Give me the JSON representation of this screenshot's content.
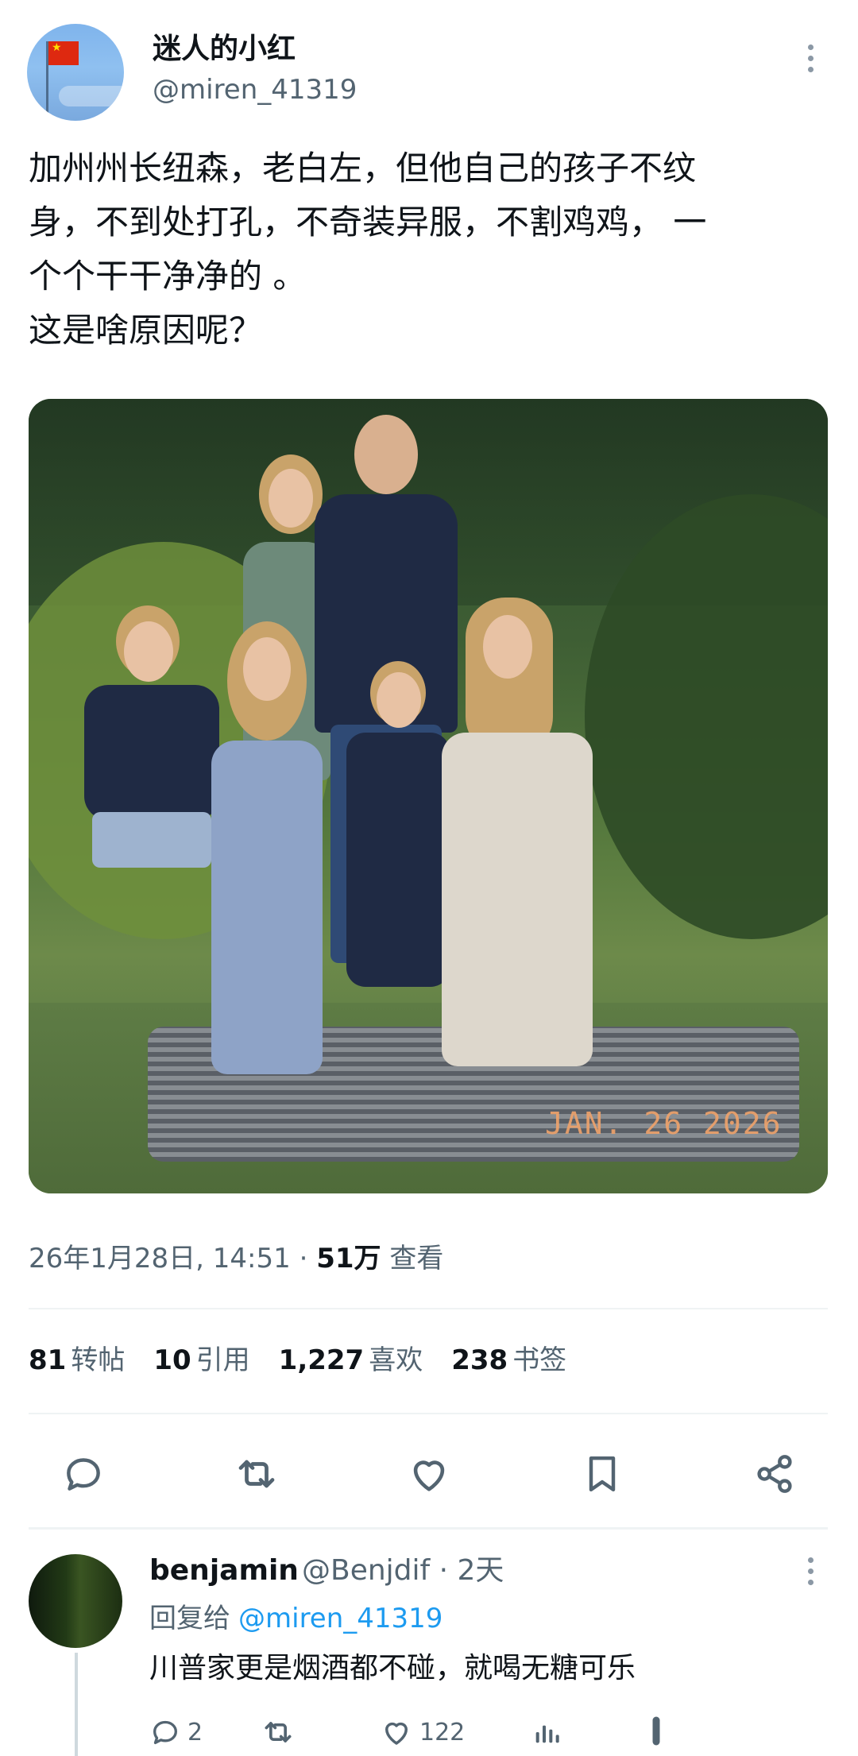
{
  "post": {
    "author_name": "迷人的小红",
    "author_handle": "@miren_41319",
    "text": "加州州长纽森，老白左，但他自己的孩子不纹\n身，不到处打孔，不奇装异服，不割鸡鸡， 一\n个个干干净净的 。\n这是啥原因呢？",
    "photo_date_stamp": "JAN. 26 2026",
    "timestamp": "26年1月28日, 14:51 · ",
    "views_count": "51万",
    "views_label": " 查看",
    "stats": [
      {
        "num": "81",
        "label": "转帖"
      },
      {
        "num": "10",
        "label": "引用"
      },
      {
        "num": "1,227",
        "label": "喜欢"
      },
      {
        "num": "238",
        "label": "书签"
      }
    ]
  },
  "reply": {
    "author_name": "benjamin",
    "author_handle_time": "@Benjdif · 2天",
    "reply_to_label": "回复给",
    "reply_to_handle": "@miren_41319",
    "text": "川普家更是烟酒都不碰，就喝无糖可乐",
    "replies": "2",
    "likes": "122"
  },
  "colors": {
    "text": "#0f1419",
    "secondary": "#536471",
    "link": "#1d9bf0",
    "divider": "#eff3f4"
  },
  "icons": [
    "reply-icon",
    "retweet-icon",
    "like-icon",
    "bookmark-icon",
    "share-icon",
    "more-icon",
    "views-icon"
  ]
}
